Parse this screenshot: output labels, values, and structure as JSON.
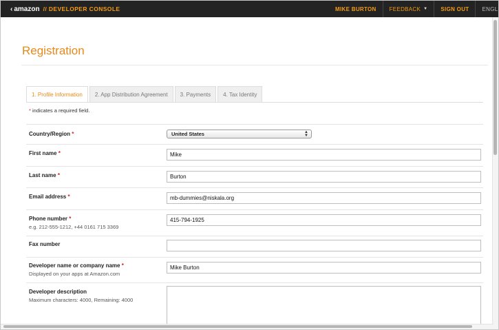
{
  "topbar": {
    "logo_text": "amazon",
    "console_title": "// DEVELOPER CONSOLE",
    "user_name": "MIKE BURTON",
    "feedback_label": "FEEDBACK",
    "signout_label": "SIGN OUT",
    "language_label": "ENGLI"
  },
  "page": {
    "title": "Registration"
  },
  "tabs": [
    {
      "label": "1. Profile Information",
      "active": true
    },
    {
      "label": "2. App Distribution Agreement",
      "active": false
    },
    {
      "label": "3. Payments",
      "active": false
    },
    {
      "label": "4. Tax Identity",
      "active": false
    }
  ],
  "required_note": {
    "star": "*",
    "text": "indicates a required field."
  },
  "form": {
    "country": {
      "label": "Country/Region",
      "star": "*",
      "value": "United States"
    },
    "first_name": {
      "label": "First name",
      "star": "*",
      "value": "Mike"
    },
    "last_name": {
      "label": "Last name",
      "star": "*",
      "value": "Burton"
    },
    "email": {
      "label": "Email address",
      "star": "*",
      "value": "mb-dummies@niskala.org"
    },
    "phone": {
      "label": "Phone number",
      "star": "*",
      "hint": "e.g. 212-555-1212, +44 0161 715 3369",
      "value": "415-794-1925"
    },
    "fax": {
      "label": "Fax number",
      "value": ""
    },
    "developer_name": {
      "label": "Developer name or company name",
      "star": "*",
      "hint": "Displayed on your apps at Amazon.com",
      "value": "Mike Burton"
    },
    "developer_description": {
      "label": "Developer description",
      "hint": "Maximum characters: 4000, Remaining: 4000",
      "value": ""
    }
  }
}
